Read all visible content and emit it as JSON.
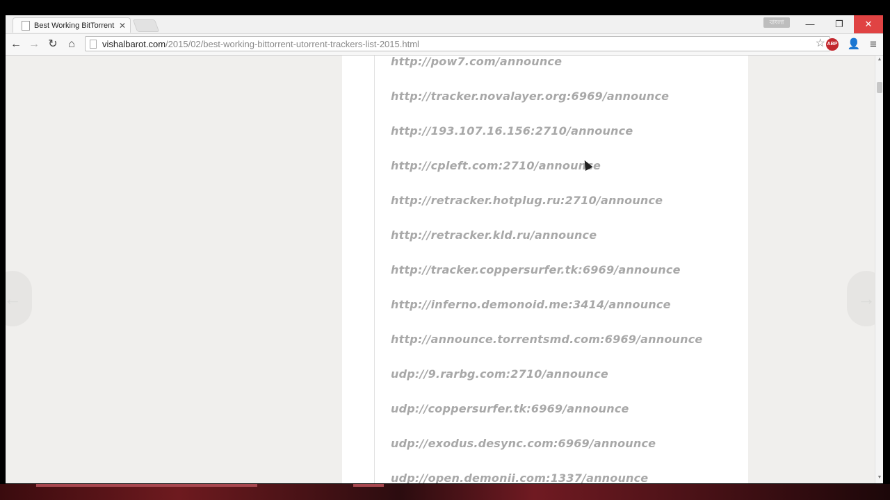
{
  "browser": {
    "tab_title": "Best Working BitTorrent /",
    "tab_close": "✕",
    "lang_badge": "বাংলা",
    "window": {
      "minimize": "—",
      "restore": "❐",
      "close": "✕"
    },
    "url_host": "vishalbarot.com",
    "url_path": "/2015/02/best-working-bittorrent-utorrent-trackers-list-2015.html",
    "nav": {
      "back": "←",
      "forward": "→",
      "reload": "↻",
      "home": "⌂"
    },
    "star": "☆",
    "ext_abp_label": "ABP",
    "ext_user": "👤",
    "menu": "≡"
  },
  "trackers": [
    "http://pow7.com/announce",
    "http://tracker.novalayer.org:6969/announce",
    "http://193.107.16.156:2710/announce",
    "http://cpleft.com:2710/announce",
    "http://retracker.hotplug.ru:2710/announce",
    "http://retracker.kld.ru/announce",
    "http://tracker.coppersurfer.tk:6969/announce",
    "http://inferno.demonoid.me:3414/announce",
    "http://announce.torrentsmd.com:6969/announce",
    "udp://9.rarbg.com:2710/announce",
    "udp://coppersurfer.tk:6969/announce",
    "udp://exodus.desync.com:6969/announce",
    "udp://open.demonii.com:1337/announce"
  ],
  "pager": {
    "prev": "←",
    "next": "→"
  },
  "scroll": {
    "up": "▲",
    "down": "▼"
  }
}
